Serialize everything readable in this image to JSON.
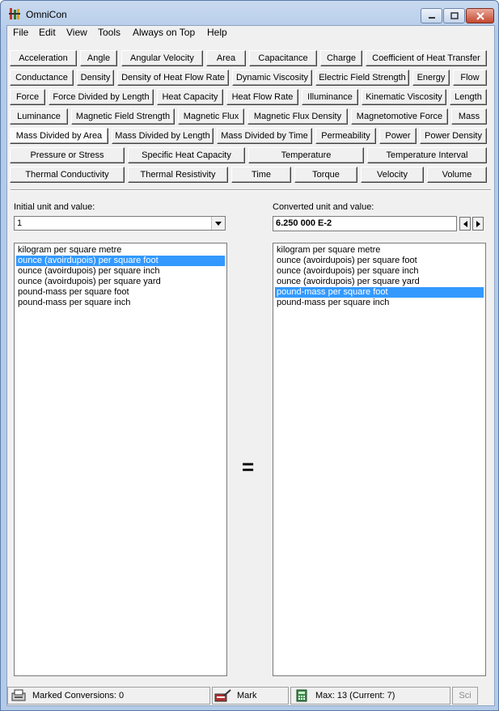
{
  "window": {
    "title": "OmniCon"
  },
  "menu": [
    "File",
    "Edit",
    "View",
    "Tools",
    "Always on Top",
    "Help"
  ],
  "tabs": {
    "row1": [
      "Acceleration",
      "Angle",
      "Angular Velocity",
      "Area",
      "Capacitance",
      "Charge",
      "Coefficient of Heat Transfer"
    ],
    "row2": [
      "Conductance",
      "Density",
      "Density of Heat Flow Rate",
      "Dynamic Viscosity",
      "Electric Field Strength",
      "Energy",
      "Flow"
    ],
    "row3": [
      "Force",
      "Force Divided by Length",
      "Heat Capacity",
      "Heat Flow Rate",
      "Illuminance",
      "Kinematic Viscosity",
      "Length"
    ],
    "row4": [
      "Luminance",
      "Magnetic Field Strength",
      "Magnetic Flux",
      "Magnetic Flux Density",
      "Magnetomotive Force",
      "Mass"
    ],
    "row5": [
      "Mass Divided by Area",
      "Mass Divided by Length",
      "Mass Divided by Time",
      "Permeability",
      "Power",
      "Power Density"
    ],
    "row6": [
      "Pressure or Stress",
      "Specific Heat Capacity",
      "Temperature",
      "Temperature Interval"
    ],
    "row7": [
      "Thermal Conductivity",
      "Thermal Resistivity",
      "Time",
      "Torque",
      "Velocity",
      "Volume"
    ],
    "active": "Mass Divided by Area"
  },
  "input": {
    "label": "Initial unit and value:",
    "value": "1",
    "units": [
      "kilogram per square metre",
      "ounce (avoirdupois) per square foot",
      "ounce (avoirdupois) per square inch",
      "ounce (avoirdupois) per square yard",
      "pound-mass per square foot",
      "pound-mass per square inch"
    ],
    "selected_index": 1
  },
  "output": {
    "label": "Converted unit and value:",
    "value": "6.250 000 E-2",
    "units": [
      "kilogram per square metre",
      "ounce (avoirdupois) per square foot",
      "ounce (avoirdupois) per square inch",
      "ounce (avoirdupois) per square yard",
      "pound-mass per square foot",
      "pound-mass per square inch"
    ],
    "selected_index": 4
  },
  "equals_sign": "=",
  "status": {
    "marked": "Marked Conversions: 0",
    "mark": "Mark",
    "max": "Max: 13  (Current: 7)",
    "sci": "Sci"
  }
}
